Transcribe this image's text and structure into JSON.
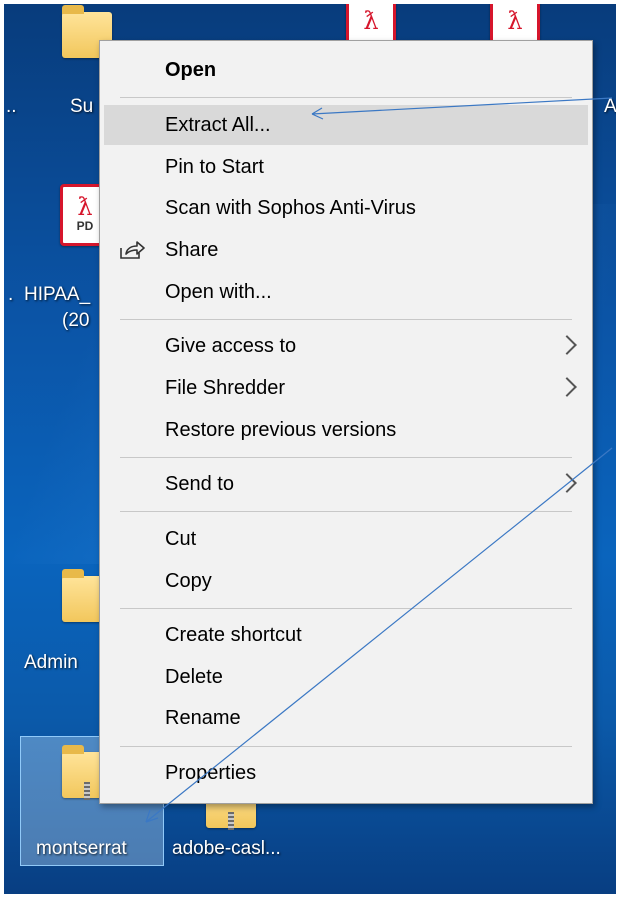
{
  "desktop": {
    "icons": [
      {
        "label": "Su"
      },
      {
        "label": "HIPAA_"
      },
      {
        "label": "(20"
      },
      {
        "label": "Admin"
      },
      {
        "label": "montserrat"
      },
      {
        "label": "adobe-casl..."
      }
    ],
    "edge_fragments": {
      "left_top": "..",
      "left_mid": ".",
      "right_top": "A"
    },
    "pdf_tag": "PD"
  },
  "context_menu": {
    "items": [
      {
        "label": "Open",
        "bold": true
      },
      {
        "label": "Extract All...",
        "highlighted": true
      },
      {
        "label": "Pin to Start"
      },
      {
        "label": "Scan with Sophos Anti-Virus"
      },
      {
        "label": "Share",
        "icon": "share-icon"
      },
      {
        "label": "Open with..."
      },
      {
        "label": "Give access to",
        "submenu": true
      },
      {
        "label": "File Shredder",
        "submenu": true
      },
      {
        "label": "Restore previous versions"
      },
      {
        "label": "Send to",
        "submenu": true
      },
      {
        "label": "Cut"
      },
      {
        "label": "Copy"
      },
      {
        "label": "Create shortcut"
      },
      {
        "label": "Delete"
      },
      {
        "label": "Rename"
      },
      {
        "label": "Properties"
      }
    ]
  },
  "colors": {
    "menu_background": "#f2f2f2",
    "menu_highlight": "#d9d9d9",
    "annotation_arrow": "#3b78c4",
    "desktop_accent": "#0a64bd"
  }
}
